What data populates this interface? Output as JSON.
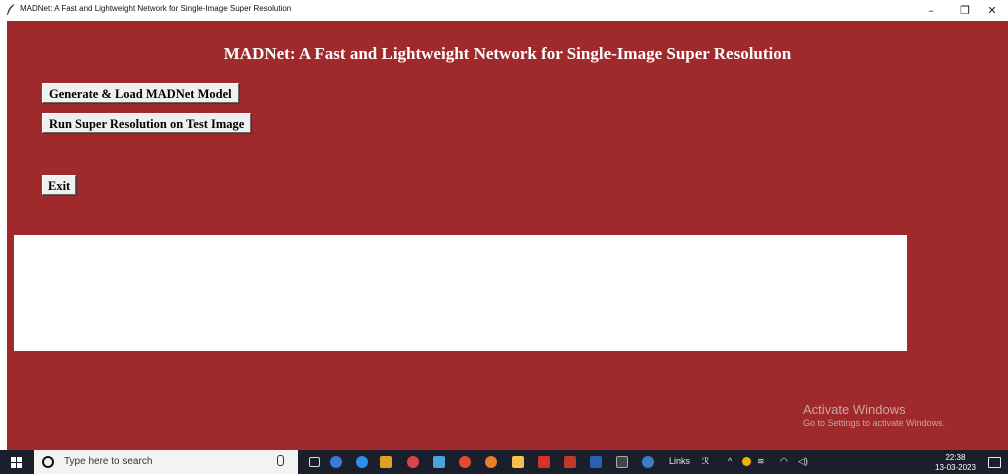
{
  "window": {
    "title": "MADNet: A Fast and Lightweight Network for Single-Image Super Resolution",
    "minimize": "–",
    "maximize": "❐",
    "close": "✕"
  },
  "app": {
    "heading": "MADNet: A Fast and Lightweight Network for Single-Image Super Resolution",
    "buttons": {
      "generate": "Generate & Load MADNet Model",
      "run": "Run Super Resolution on Test Image",
      "exit": "Exit"
    },
    "output_text": ""
  },
  "watermark": {
    "line1": "Activate Windows",
    "line2": "Go to Settings to activate Windows."
  },
  "taskbar": {
    "search_placeholder": "Type here to search",
    "links_label": "Links",
    "time": "22:38",
    "date": "13-03-2023"
  }
}
